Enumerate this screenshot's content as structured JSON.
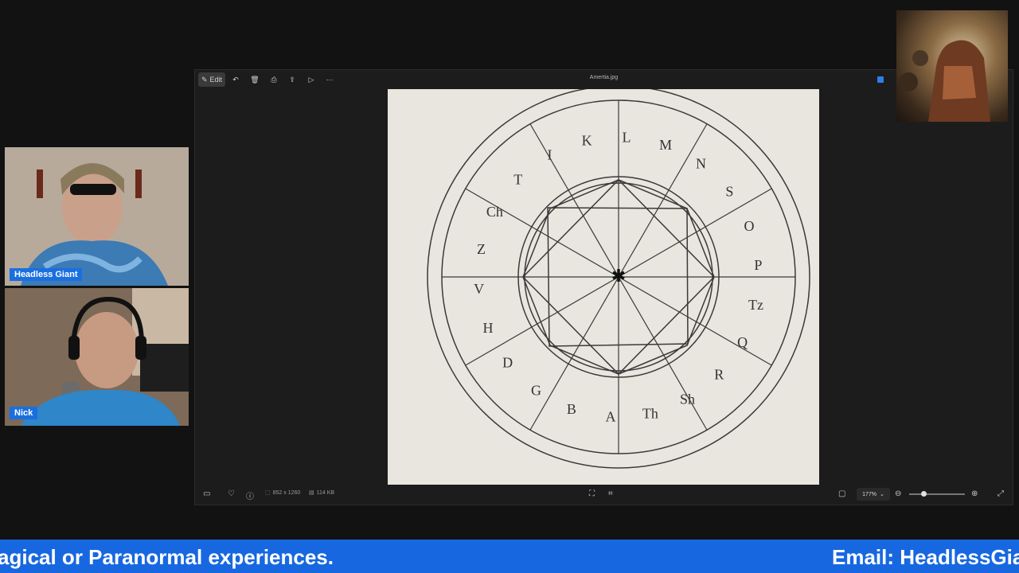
{
  "viewer": {
    "title": "Amertia.jpg",
    "toolbar": {
      "edit_label": "Edit",
      "icons": [
        "edit-icon",
        "rotate-icon",
        "delete-icon",
        "print-icon",
        "share-icon",
        "slideshow-icon",
        "more-icon"
      ]
    },
    "status": {
      "dimensions": "852 x 1260",
      "file_size": "114 KB",
      "zoom": "177%"
    },
    "image": {
      "ring_letters": [
        "A",
        "B",
        "G",
        "D",
        "H",
        "V",
        "Z",
        "Ch",
        "T",
        "I",
        "K",
        "L",
        "M",
        "N",
        "S",
        "O",
        "P",
        "Tz",
        "Q",
        "R",
        "Sh",
        "Th"
      ]
    }
  },
  "participants": [
    {
      "name": "Headless Giant"
    },
    {
      "name": "Nick"
    }
  ],
  "ticker": {
    "left_text": "agical or Paranormal experiences.",
    "right_text": "Email: HeadlessGian"
  },
  "colors": {
    "accent": "#1768e0",
    "name_tag": "#1a6fe0",
    "window_bg": "#1c1c1c",
    "page_bg": "#121212"
  }
}
